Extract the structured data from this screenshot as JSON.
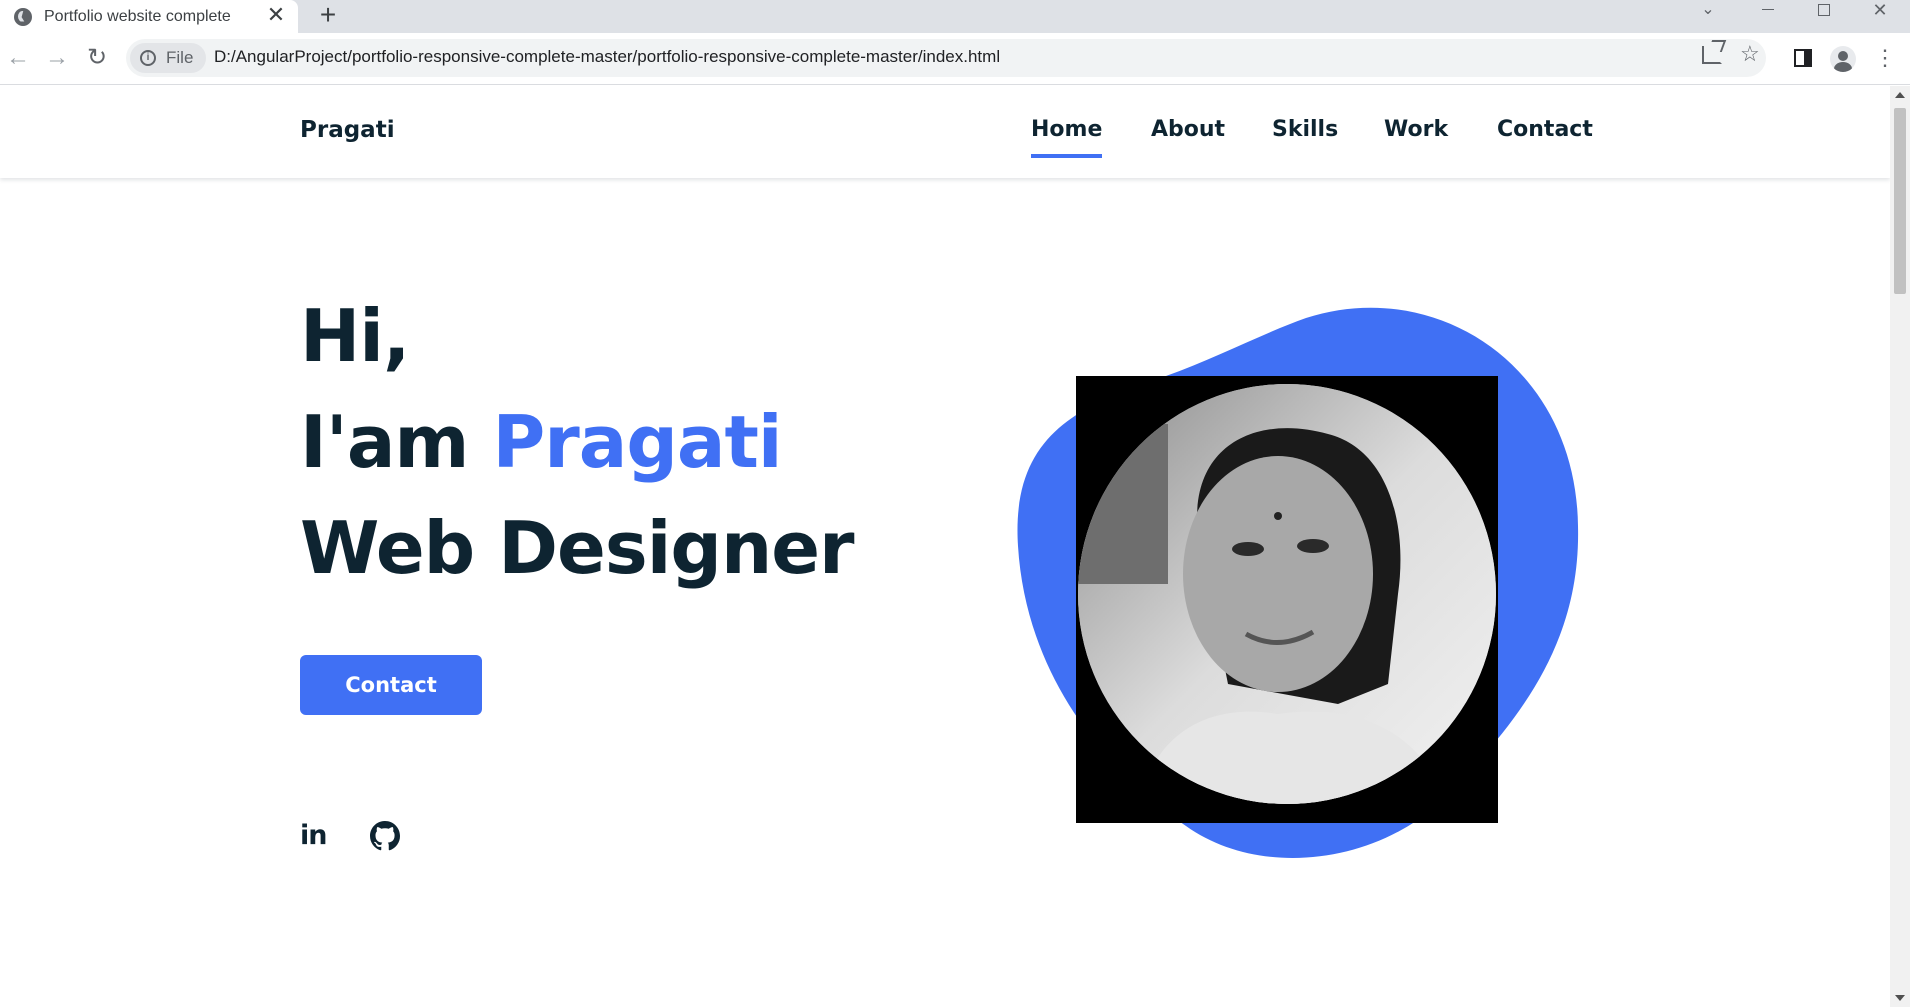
{
  "browser": {
    "tab_title": "Portfolio website complete",
    "tab_close": "✕",
    "new_tab": "+",
    "chip_label": "File",
    "url": "D:/AngularProject/portfolio-responsive-complete-master/portfolio-responsive-complete-master/index.html",
    "back": "←",
    "forward": "→",
    "reload": "↻",
    "star": "☆",
    "menu": "⋮",
    "dropdown": "⌄",
    "close_window": "✕"
  },
  "site": {
    "logo": "Pragati",
    "nav": [
      {
        "label": "Home",
        "active": true
      },
      {
        "label": "About",
        "active": false
      },
      {
        "label": "Skills",
        "active": false
      },
      {
        "label": "Work",
        "active": false
      },
      {
        "label": "Contact",
        "active": false
      }
    ],
    "hero": {
      "greeting": "Hi,",
      "intro": "I'am ",
      "name": "Pragati",
      "role": "Web Designer",
      "button": "Contact"
    },
    "social": {
      "linkedin": "in"
    }
  },
  "colors": {
    "accent": "#4070f4",
    "text": "#0e2431"
  }
}
